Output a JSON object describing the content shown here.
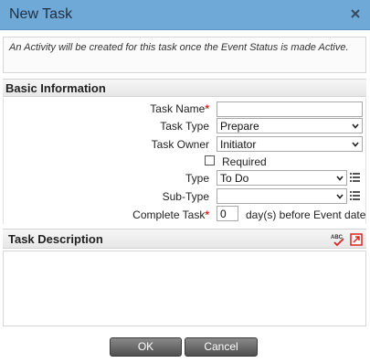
{
  "window": {
    "title": "New Task"
  },
  "info": {
    "message": "An Activity will be created for this task once the Event Status is made Active."
  },
  "basic_information": {
    "heading": "Basic Information",
    "task_name": {
      "label": "Task Name",
      "required_mark": "*",
      "value": ""
    },
    "task_type": {
      "label": "Task Type",
      "value": "Prepare"
    },
    "task_owner": {
      "label": "Task Owner",
      "value": "Initiator"
    },
    "required": {
      "label": "Required",
      "checked": false
    },
    "type": {
      "label": "Type",
      "value": "To Do"
    },
    "sub_type": {
      "label": "Sub-Type",
      "value": ""
    },
    "complete_task": {
      "label": "Complete Task",
      "required_mark": "*",
      "value": "0",
      "suffix": "day(s) before Event date"
    }
  },
  "task_description": {
    "heading": "Task Description",
    "value": ""
  },
  "footer": {
    "ok_label": "OK",
    "cancel_label": "Cancel"
  },
  "colors": {
    "titlebar": "#6fa9d8",
    "required": "#dd2222",
    "button": "#5c5c5c"
  },
  "icons": [
    "close-icon",
    "chevron-down-icon",
    "list-icon",
    "spellcheck-icon",
    "expand-icon"
  ]
}
